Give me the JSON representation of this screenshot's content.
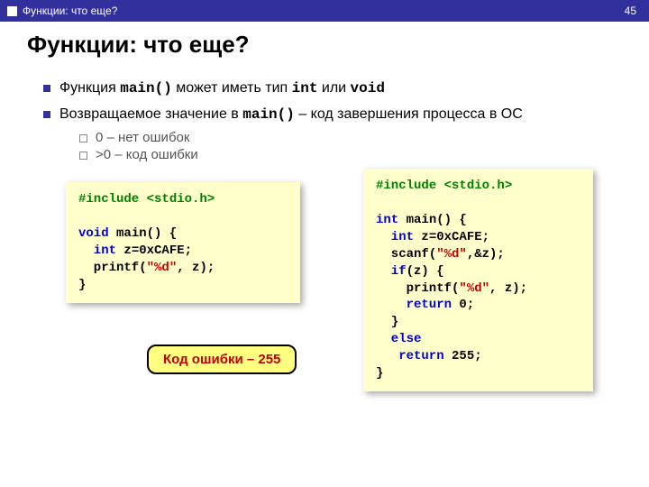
{
  "header": {
    "breadcrumb": "Функции: что еще?",
    "page_number": "45"
  },
  "title": "Функции: что еще?",
  "bullets": {
    "item1_pre": "Функция ",
    "item1_code1": "main()",
    "item1_mid": " может иметь тип ",
    "item1_code2": "int",
    "item1_mid2": " или ",
    "item1_code3": "void",
    "item2_pre": "Возвращаемое значение в ",
    "item2_code": "main()",
    "item2_post": " – код завершения процесса в ОС"
  },
  "sub_bullets": {
    "s1": "0 – нет ошибок",
    "s2": ">0 – код ошибки"
  },
  "code_left": {
    "l1a": "#include ",
    "l1b": "<stdio.h>",
    "l2": "",
    "l3a": "void",
    "l3b": " main() {",
    "l4a": "  int",
    "l4b": " z=0xCAFE;",
    "l5a": "  printf(",
    "l5b": "\"%d\"",
    "l5c": ", z);",
    "l6": "}"
  },
  "code_right": {
    "l1a": "#include ",
    "l1b": "<stdio.h>",
    "l2": "",
    "l3a": "int",
    "l3b": " main() {",
    "l4a": "  int",
    "l4b": " z=0xCAFE;",
    "l5a": "  scanf(",
    "l5b": "\"%d\"",
    "l5c": ",&z);",
    "l6a": "  if",
    "l6b": "(z) {",
    "l7a": "    printf(",
    "l7b": "\"%d\"",
    "l7c": ", z);",
    "l8a": "    return",
    "l8b": " 0;",
    "l9": "  }",
    "l10a": "  else",
    "l11a": "   return",
    "l11b": " 255;",
    "l12": "}"
  },
  "callout": "Код ошибки – 255"
}
